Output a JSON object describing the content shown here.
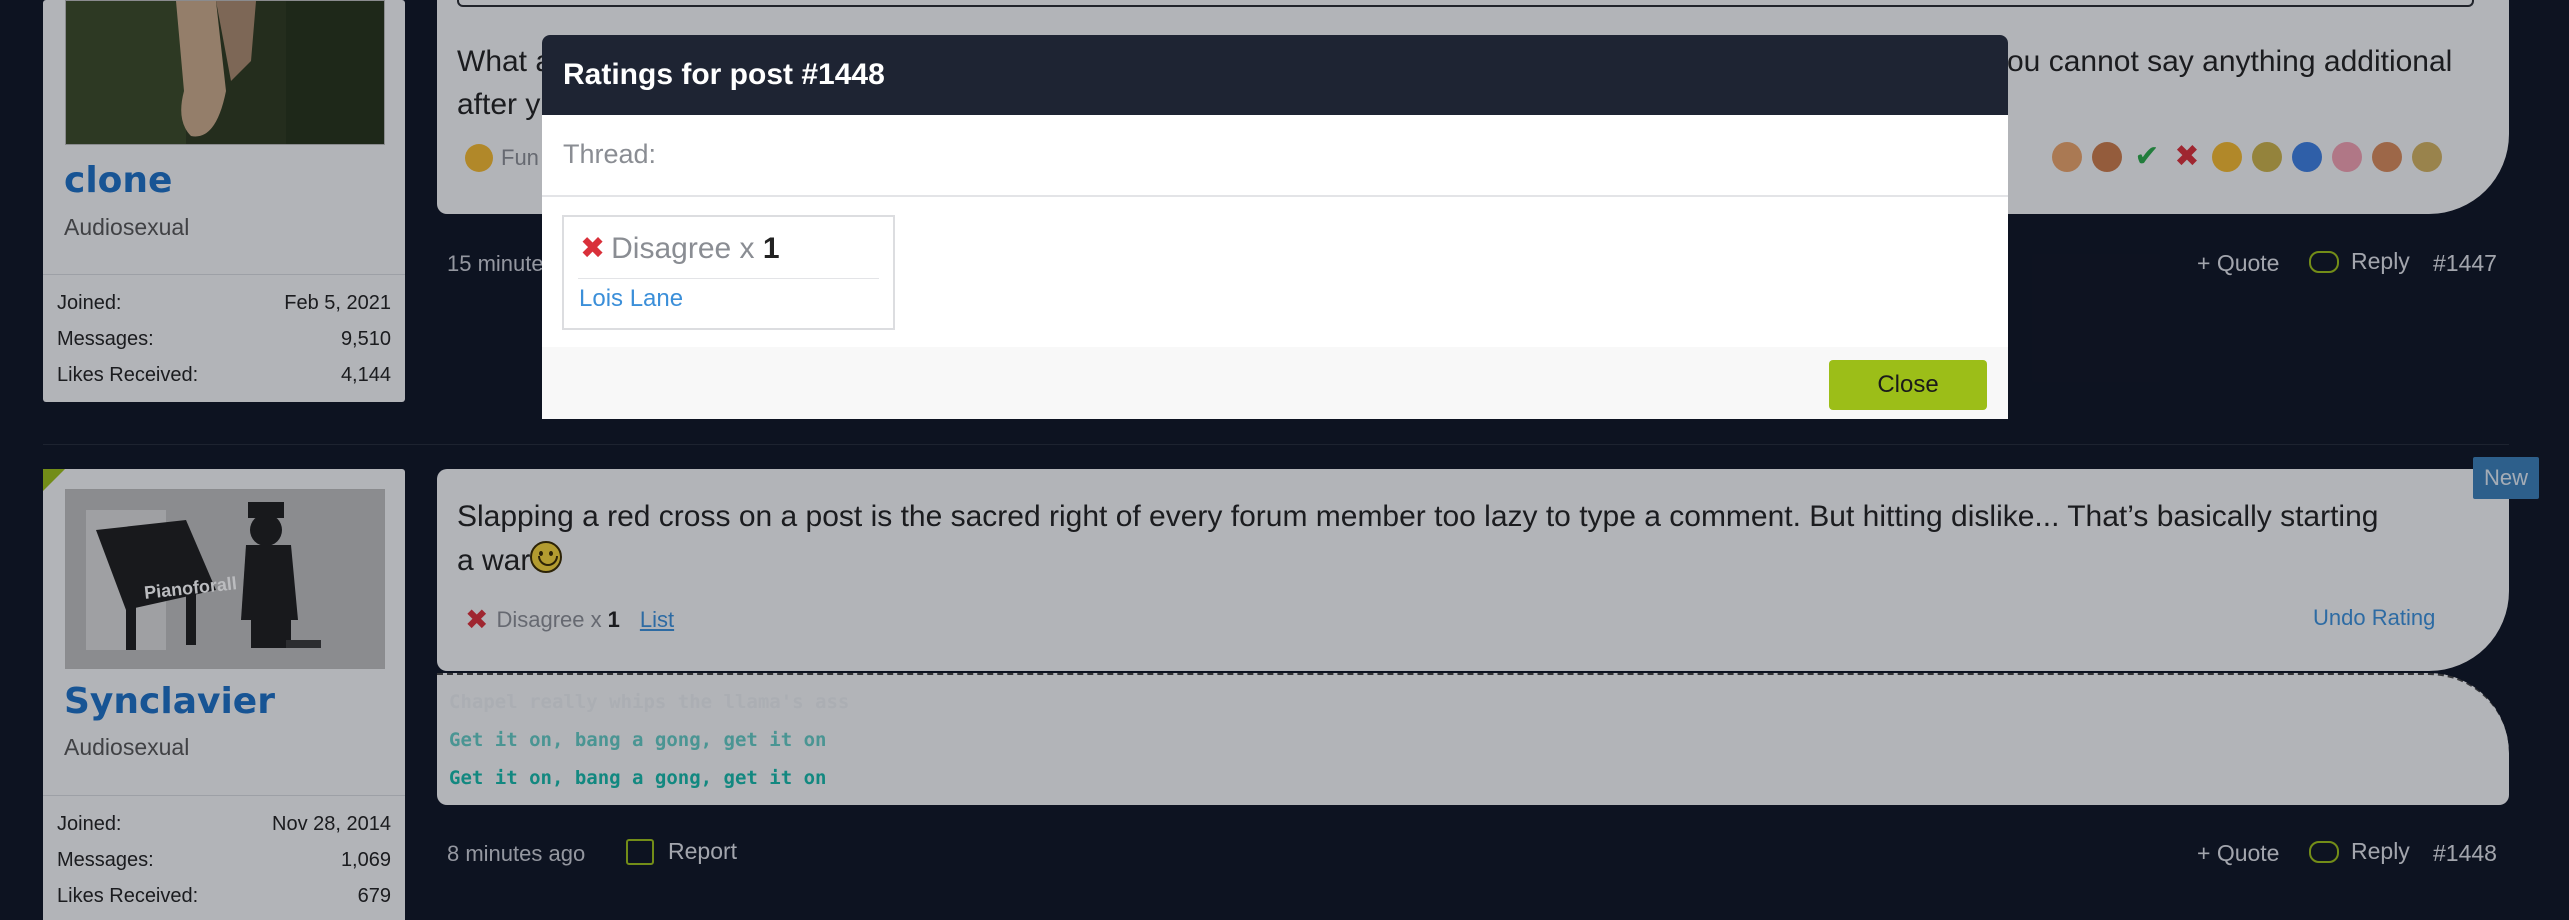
{
  "post_1447": {
    "user": {
      "name": "clone",
      "title": "Audiosexual"
    },
    "stats": [
      {
        "label": "Joined:",
        "value": "Feb 5, 2021"
      },
      {
        "label": "Messages:",
        "value": "9,510"
      },
      {
        "label": "Likes Received:",
        "value": "4,144"
      }
    ],
    "text_line1_start": "What a",
    "text_line1_end": "you cannot say anything additional",
    "text_line2": "after y",
    "reaction_partial": "Fun",
    "time": "15 minute",
    "quote": "+ Quote",
    "reply": "Reply",
    "post_number": "#1447",
    "rating_icons": [
      "thumb-up-icon",
      "thumb-down-icon",
      "check-icon",
      "cross-icon",
      "laugh-icon",
      "award-icon",
      "info-icon",
      "heart-icon",
      "wrench-icon",
      "pencil-icon"
    ]
  },
  "post_1448": {
    "user": {
      "name": "Synclavier",
      "title": "Audiosexual",
      "avatar_caption": "Pianoforall"
    },
    "stats": [
      {
        "label": "Joined:",
        "value": "Nov 28, 2014"
      },
      {
        "label": "Messages:",
        "value": "1,069"
      },
      {
        "label": "Likes Received:",
        "value": "679"
      }
    ],
    "new_badge": "New",
    "text_line1": "Slapping a red cross on a post is the sacred right of every forum member too lazy to type a comment. But hitting dislike... That’s basically starting",
    "text_line2": "a war",
    "rating_label": "Disagree x",
    "rating_count": "1",
    "list_link": "List",
    "undo_rating": "Undo Rating",
    "signature": [
      "Chapel really whips the llama's ass",
      "Get it on, bang a gong, get it on",
      "Get it on, bang a gong, get it on"
    ],
    "time": "8 minutes ago",
    "report": "Report",
    "quote": "+ Quote",
    "reply": "Reply",
    "post_number": "#1448"
  },
  "modal": {
    "title": "Ratings for post #1448",
    "thread_label": "Thread:",
    "rating_label": "Disagree x",
    "rating_count": "1",
    "rating_user": "Lois Lane",
    "close_label": "Close"
  },
  "colors": {
    "background": "#0f1524",
    "card": "#f3f4f6",
    "username": "#1d6fc4",
    "modal_header": "#1e2433",
    "close_button": "#9cbe18",
    "link": "#3b8fd9",
    "disagree_red": "#d9303a"
  }
}
